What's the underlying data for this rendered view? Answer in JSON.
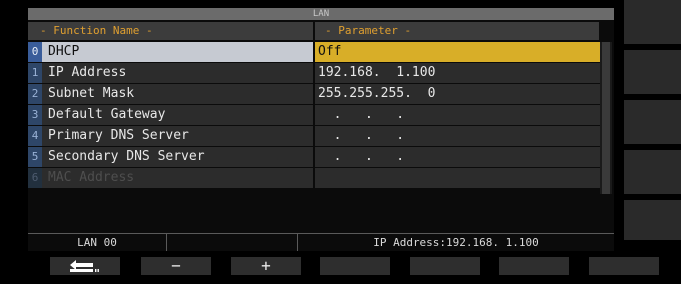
{
  "window": {
    "title": "LAN"
  },
  "columns": {
    "name": "- Function Name -",
    "param": "- Parameter -"
  },
  "rows": [
    {
      "index": "0",
      "name": "DHCP",
      "value": "Off"
    },
    {
      "index": "1",
      "name": "IP Address",
      "value": "192.168.  1.100"
    },
    {
      "index": "2",
      "name": "Subnet Mask",
      "value": "255.255.255.  0"
    },
    {
      "index": "3",
      "name": "Default Gateway",
      "value": "  .   .   ."
    },
    {
      "index": "4",
      "name": "Primary DNS Server",
      "value": "  .   .   ."
    },
    {
      "index": "5",
      "name": "Secondary DNS Server",
      "value": "  .   .   ."
    },
    {
      "index": "6",
      "name": "MAC Address",
      "value": ""
    }
  ],
  "status": {
    "left": "LAN 00",
    "middle": "",
    "right": "IP Address:192.168.  1.100"
  },
  "function_keys": [
    {
      "icon": "back-arrow-icon",
      "label": ""
    },
    {
      "icon": "minus-icon",
      "label": "−"
    },
    {
      "icon": "plus-icon",
      "label": "+"
    },
    {
      "label": ""
    },
    {
      "label": ""
    },
    {
      "label": ""
    },
    {
      "label": ""
    }
  ],
  "colors": {
    "selected_value": "#d8ae28",
    "header_text": "#e0a030",
    "index_badge": "#2e4668"
  }
}
